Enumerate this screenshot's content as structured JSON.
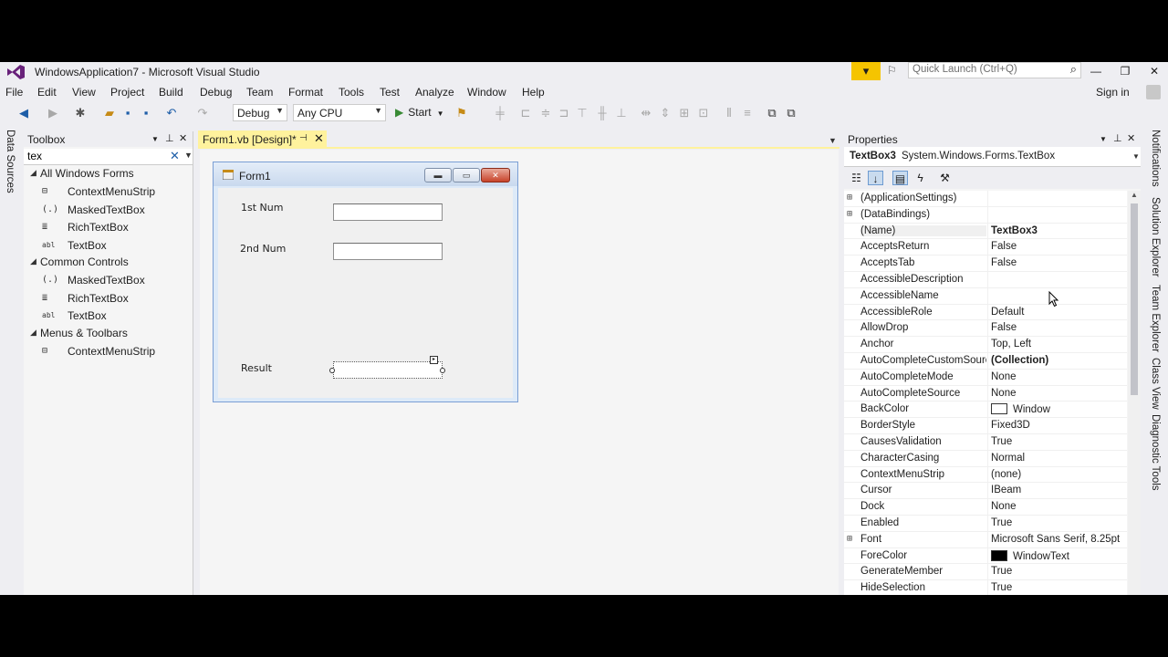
{
  "window": {
    "title": "WindowsApplication7 - Microsoft Visual Studio",
    "quick_launch_placeholder": "Quick Launch (Ctrl+Q)",
    "sign_in": "Sign in"
  },
  "menu": [
    "File",
    "Edit",
    "View",
    "Project",
    "Build",
    "Debug",
    "Team",
    "Format",
    "Tools",
    "Test",
    "Analyze",
    "Window",
    "Help"
  ],
  "toolbar": {
    "configuration": "Debug",
    "platform": "Any CPU",
    "start_label": "Start"
  },
  "left_tabs": [
    "Data Sources"
  ],
  "right_tabs": [
    "Notifications",
    "Solution Explorer",
    "Team Explorer",
    "Class View",
    "Diagnostic Tools"
  ],
  "toolbox": {
    "title": "Toolbox",
    "search_value": "tex",
    "sections": [
      {
        "name": "All Windows Forms",
        "items": [
          {
            "icon": "context-menu-strip-icon",
            "glyph": "⊟",
            "label": "ContextMenuStrip"
          },
          {
            "icon": "masked-textbox-icon",
            "glyph": "(.)",
            "label": "MaskedTextBox"
          },
          {
            "icon": "rich-textbox-icon",
            "glyph": "≣",
            "label": "RichTextBox"
          },
          {
            "icon": "textbox-icon",
            "glyph": "abl",
            "label": "TextBox"
          }
        ]
      },
      {
        "name": "Common Controls",
        "items": [
          {
            "icon": "masked-textbox-icon",
            "glyph": "(.)",
            "label": "MaskedTextBox"
          },
          {
            "icon": "rich-textbox-icon",
            "glyph": "≣",
            "label": "RichTextBox"
          },
          {
            "icon": "textbox-icon",
            "glyph": "abl",
            "label": "TextBox"
          }
        ]
      },
      {
        "name": "Menus & Toolbars",
        "items": [
          {
            "icon": "context-menu-strip-icon",
            "glyph": "⊟",
            "label": "ContextMenuStrip"
          }
        ]
      }
    ]
  },
  "document": {
    "tab_label": "Form1.vb [Design]*",
    "form": {
      "title": "Form1",
      "label1": "1st Num",
      "label2": "2nd Num",
      "label3": "Result"
    }
  },
  "properties": {
    "title": "Properties",
    "object_name": "TextBox3",
    "object_type": "System.Windows.Forms.TextBox",
    "rows": [
      {
        "name": "(ApplicationSettings)",
        "value": "",
        "expandable": true
      },
      {
        "name": "(DataBindings)",
        "value": "",
        "expandable": true
      },
      {
        "name": "(Name)",
        "value": "TextBox3",
        "bold": true,
        "selected": true
      },
      {
        "name": "AcceptsReturn",
        "value": "False"
      },
      {
        "name": "AcceptsTab",
        "value": "False"
      },
      {
        "name": "AccessibleDescription",
        "value": ""
      },
      {
        "name": "AccessibleName",
        "value": ""
      },
      {
        "name": "AccessibleRole",
        "value": "Default"
      },
      {
        "name": "AllowDrop",
        "value": "False"
      },
      {
        "name": "Anchor",
        "value": "Top, Left"
      },
      {
        "name": "AutoCompleteCustomSource",
        "value": "(Collection)",
        "bold": true
      },
      {
        "name": "AutoCompleteMode",
        "value": "None"
      },
      {
        "name": "AutoCompleteSource",
        "value": "None"
      },
      {
        "name": "BackColor",
        "value": "Window",
        "swatch": "#ffffff"
      },
      {
        "name": "BorderStyle",
        "value": "Fixed3D"
      },
      {
        "name": "CausesValidation",
        "value": "True"
      },
      {
        "name": "CharacterCasing",
        "value": "Normal"
      },
      {
        "name": "ContextMenuStrip",
        "value": "(none)"
      },
      {
        "name": "Cursor",
        "value": "IBeam"
      },
      {
        "name": "Dock",
        "value": "None"
      },
      {
        "name": "Enabled",
        "value": "True"
      },
      {
        "name": "Font",
        "value": "Microsoft Sans Serif, 8.25pt",
        "expandable": true
      },
      {
        "name": "ForeColor",
        "value": "WindowText",
        "swatch": "#000000"
      },
      {
        "name": "GenerateMember",
        "value": "True"
      },
      {
        "name": "HideSelection",
        "value": "True"
      }
    ]
  },
  "colors": {
    "accent_purple": "#68217a",
    "tab_active": "#fff29d",
    "feedback_badge": "#f5c400"
  }
}
